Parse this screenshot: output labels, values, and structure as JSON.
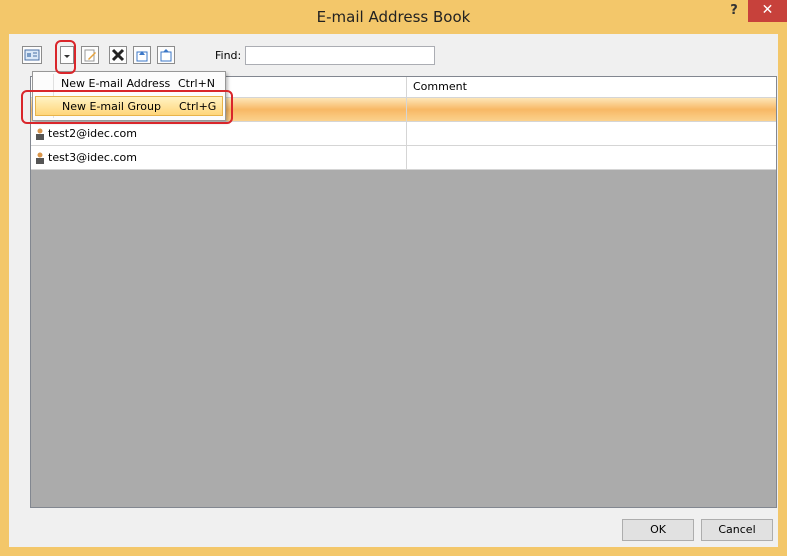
{
  "window": {
    "title": "E-mail Address Book",
    "help": "?",
    "close": "✕"
  },
  "toolbar": {
    "find_label": "Find:",
    "find_value": ""
  },
  "table": {
    "columns": [
      "",
      "Comment"
    ],
    "rows": [
      {
        "address": "",
        "comment": ""
      },
      {
        "address": "test2@idec.com",
        "comment": ""
      },
      {
        "address": "test3@idec.com",
        "comment": ""
      }
    ]
  },
  "menu": {
    "items": [
      {
        "label": "New E-mail Address",
        "shortcut": "Ctrl+N"
      },
      {
        "label": "New E-mail Group",
        "shortcut": "Ctrl+G"
      }
    ]
  },
  "buttons": {
    "ok": "OK",
    "cancel": "Cancel"
  },
  "colors": {
    "frame": "#f3c76a",
    "close": "#c7413b",
    "highlight": "#d9262b",
    "selected_row": "#f8b865"
  }
}
